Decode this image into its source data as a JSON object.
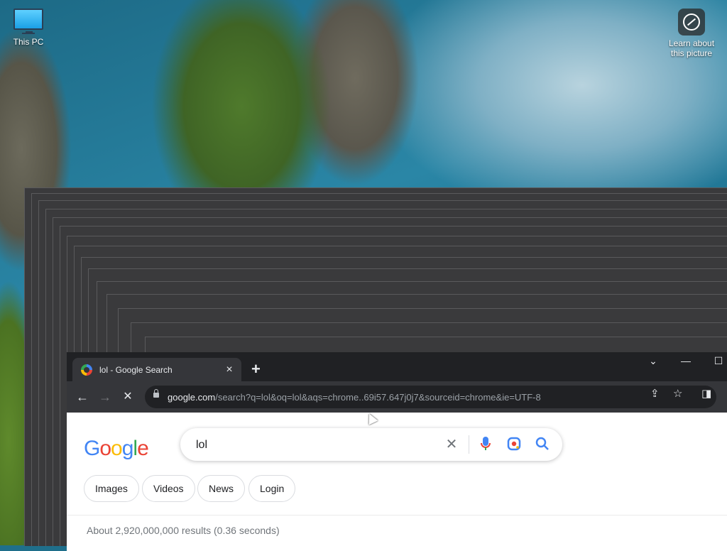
{
  "desktop": {
    "icons": [
      {
        "label": "This PC"
      },
      {
        "label": "Learn about this picture"
      }
    ]
  },
  "browser": {
    "tab": {
      "title": "lol - Google Search",
      "close": "×"
    },
    "new_tab": "+",
    "window_controls": {
      "dropdown": "⌄",
      "minimize": "—",
      "maximize": "☐"
    },
    "nav": {
      "back": "←",
      "forward": "→",
      "stop": "✕"
    },
    "omnibox": {
      "host": "google.com",
      "path": "/search?q=lol&oq=lol&aqs=chrome..69i57.647j0j7&sourceid=chrome&ie=UTF-8"
    }
  },
  "page": {
    "logo": [
      "G",
      "o",
      "o",
      "g",
      "l",
      "e"
    ],
    "logo_colors": [
      "#4285f4",
      "#ea4335",
      "#fbbc05",
      "#4285f4",
      "#34a853",
      "#ea4335"
    ],
    "search": {
      "value": "lol"
    },
    "chips": [
      "Images",
      "Videos",
      "News",
      "Login"
    ],
    "result_stats": "About 2,920,000,000 results (0.36 seconds)"
  }
}
